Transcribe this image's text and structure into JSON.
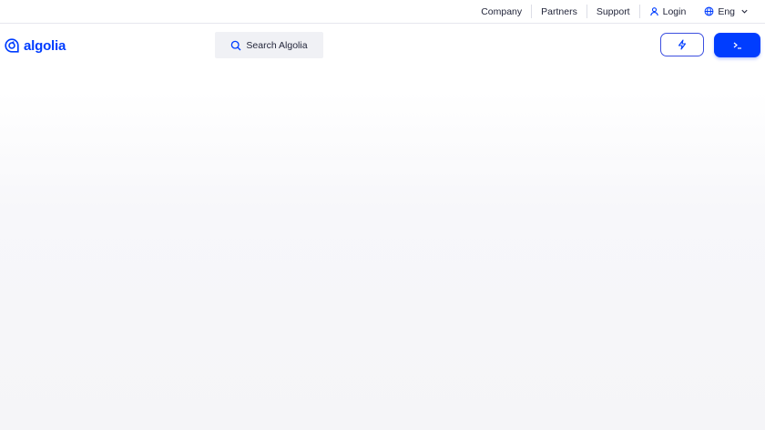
{
  "topnav": {
    "items": [
      {
        "label": "Company"
      },
      {
        "label": "Partners"
      },
      {
        "label": "Support"
      },
      {
        "label": "Login",
        "icon": "user-icon"
      },
      {
        "label": "Eng",
        "icon": "globe-icon",
        "trailing_icon": "chevron-down-icon"
      }
    ]
  },
  "header": {
    "logo_text": "algolia",
    "logo_icon": "algolia-logo-icon",
    "search_label": "Search Algolia",
    "search_icon": "search-icon",
    "outline_button_icon": "lightning-icon",
    "primary_button_icon": "terminal-icon"
  },
  "colors": {
    "brand": "#003dff",
    "text": "#23263b",
    "search_bg": "#f0f1f5",
    "divider": "#e6e7ee"
  }
}
